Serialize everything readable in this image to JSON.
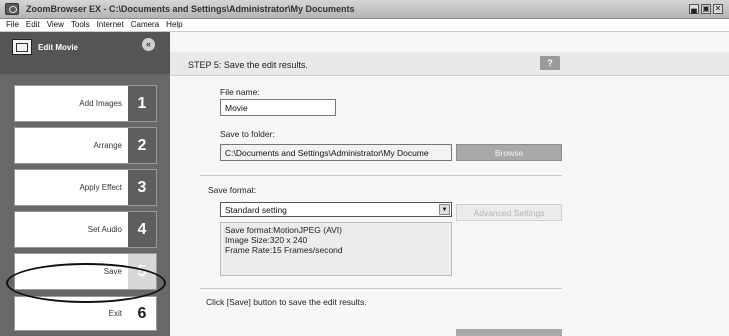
{
  "window": {
    "title": "ZoomBrowser EX  -  C:\\Documents and Settings\\Administrator\\My Documents",
    "controls": [
      "▄",
      "▣",
      "✕"
    ]
  },
  "menu": [
    "File",
    "Edit",
    "View",
    "Tools",
    "Internet",
    "Camera",
    "Help"
  ],
  "sidebar": {
    "header": "Edit Movie",
    "collapse_symbol": "«",
    "steps": [
      {
        "label": "Add Images",
        "number": "1"
      },
      {
        "label": "Arrange",
        "number": "2"
      },
      {
        "label": "Apply Effect",
        "number": "3"
      },
      {
        "label": "Set Audio",
        "number": "4"
      },
      {
        "label": "Save",
        "number": "5"
      },
      {
        "label": "Exit",
        "number": "6"
      }
    ]
  },
  "main": {
    "step_title": "STEP 5: Save the edit results.",
    "help_label": "?",
    "file_name_label": "File name:",
    "file_name_value": "Movie",
    "save_folder_label": "Save to folder:",
    "save_folder_value": "C:\\Documents and Settings\\Administrator\\My Docume",
    "browse_label": "Browse",
    "save_format_label": "Save format:",
    "save_format_value": "Standard setting",
    "advanced_label": "Advanced Settings",
    "format_info": [
      "Save format:MotionJPEG (AVI)",
      "Image Size:320 x 240",
      "Frame Rate:15 Frames/second"
    ],
    "instruction": "Click [Save] button to save the edit results."
  }
}
